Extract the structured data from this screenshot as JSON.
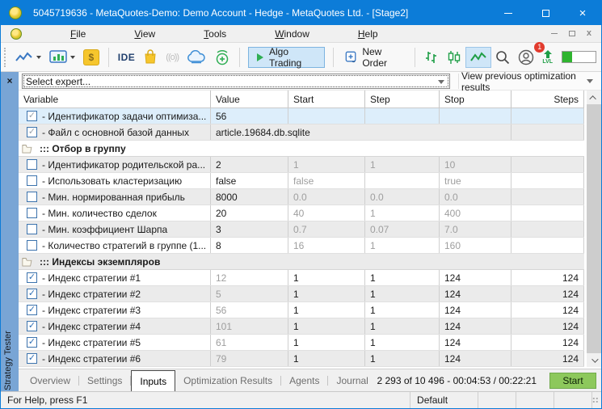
{
  "window": {
    "title": "5045719636 - MetaQuotes-Demo: Demo Account - Hedge - MetaQuotes Ltd. - [Stage2]"
  },
  "menu": {
    "items": [
      "File",
      "View",
      "Tools",
      "Window",
      "Help"
    ]
  },
  "toolbar": {
    "ide_label": "IDE",
    "signal_glyph": "((o))",
    "algo_trading_label": "Algo Trading",
    "new_order_label": "New Order",
    "notification_count": "1",
    "lvl_label": "LVL",
    "connection_fill_percent": 30
  },
  "expert_bar": {
    "close_glyph": "×",
    "expert_select_placeholder": "Select expert...",
    "results_select_value": "View previous optimization results"
  },
  "inputs_table": {
    "columns": [
      "Variable",
      "Value",
      "Start",
      "Step",
      "Stop",
      "Steps"
    ],
    "rows": [
      {
        "type": "param",
        "bg": "selected",
        "check": "on-disabled",
        "label": "- Идентификатор задачи оптимиза...",
        "value": "56",
        "start": "",
        "step": "",
        "stop": "",
        "steps": "",
        "muted": null,
        "span": false
      },
      {
        "type": "param",
        "bg": "gray",
        "check": "on-disabled",
        "label": "- Файл с основной базой данных",
        "value": "article.19684.db.sqlite",
        "start": "",
        "step": "",
        "stop": "",
        "steps": "",
        "muted": null,
        "span": true
      },
      {
        "type": "group",
        "bg": "white",
        "label": "::: Отбор в группу"
      },
      {
        "type": "param",
        "bg": "gray",
        "check": "off",
        "label": "- Идентификатор родительской ра...",
        "value": "2",
        "start": "1",
        "step": "1",
        "stop": "10",
        "steps": "",
        "muted": "range",
        "span": false
      },
      {
        "type": "param",
        "bg": "white",
        "check": "off",
        "label": "- Использовать кластеризацию",
        "value": "false",
        "start": "false",
        "step": "",
        "stop": "true",
        "steps": "",
        "muted": "range",
        "span": false
      },
      {
        "type": "param",
        "bg": "gray",
        "check": "off",
        "label": "- Мин. нормированная прибыль",
        "value": "8000",
        "start": "0.0",
        "step": "0.0",
        "stop": "0.0",
        "steps": "",
        "muted": "range",
        "span": false
      },
      {
        "type": "param",
        "bg": "white",
        "check": "off",
        "label": "- Мин. количество сделок",
        "value": "20",
        "start": "40",
        "step": "1",
        "stop": "400",
        "steps": "",
        "muted": "range",
        "span": false
      },
      {
        "type": "param",
        "bg": "gray",
        "check": "off",
        "label": "- Мин. коэффициент Шарпа",
        "value": "3",
        "start": "0.7",
        "step": "0.07",
        "stop": "7.0",
        "steps": "",
        "muted": "range",
        "span": false
      },
      {
        "type": "param",
        "bg": "white",
        "check": "off",
        "label": "- Количество стратегий в группе (1...",
        "value": "8",
        "start": "16",
        "step": "1",
        "stop": "160",
        "steps": "",
        "muted": "range",
        "span": false
      },
      {
        "type": "group",
        "bg": "gray",
        "label": "::: Индексы экземпляров"
      },
      {
        "type": "param",
        "bg": "white",
        "check": "on",
        "label": "- Индекс стратегии #1",
        "value": "12",
        "start": "1",
        "step": "1",
        "stop": "124",
        "steps": "124",
        "muted": "value",
        "span": false
      },
      {
        "type": "param",
        "bg": "gray",
        "check": "on",
        "label": "- Индекс стратегии #2",
        "value": "5",
        "start": "1",
        "step": "1",
        "stop": "124",
        "steps": "124",
        "muted": "value",
        "span": false
      },
      {
        "type": "param",
        "bg": "white",
        "check": "on",
        "label": "- Индекс стратегии #3",
        "value": "56",
        "start": "1",
        "step": "1",
        "stop": "124",
        "steps": "124",
        "muted": "value",
        "span": false
      },
      {
        "type": "param",
        "bg": "gray",
        "check": "on",
        "label": "- Индекс стратегии #4",
        "value": "101",
        "start": "1",
        "step": "1",
        "stop": "124",
        "steps": "124",
        "muted": "value",
        "span": false
      },
      {
        "type": "param",
        "bg": "white",
        "check": "on",
        "label": "- Индекс стратегии #5",
        "value": "61",
        "start": "1",
        "step": "1",
        "stop": "124",
        "steps": "124",
        "muted": "value",
        "span": false
      },
      {
        "type": "param",
        "bg": "gray",
        "check": "on",
        "label": "- Индекс стратегии #6",
        "value": "79",
        "start": "1",
        "step": "1",
        "stop": "124",
        "steps": "124",
        "muted": "value",
        "span": false
      }
    ]
  },
  "side_panel": {
    "label": "Strategy Tester"
  },
  "bottom_bar": {
    "tabs": [
      "Overview",
      "Settings",
      "Inputs",
      "Optimization Results",
      "Agents",
      "Journal"
    ],
    "active_tab": "Inputs",
    "progress_text": "2 293 of 10 496  -  00:04:53 / 00:22:21",
    "start_label": "Start"
  },
  "status_bar": {
    "help_text": "For Help, press F1",
    "profile": "Default"
  },
  "colors": {
    "titlebar": "#0c7cd8",
    "selected_row": "#ddeefb",
    "start_button": "#8dc85c",
    "strip": "#79a5d5"
  }
}
